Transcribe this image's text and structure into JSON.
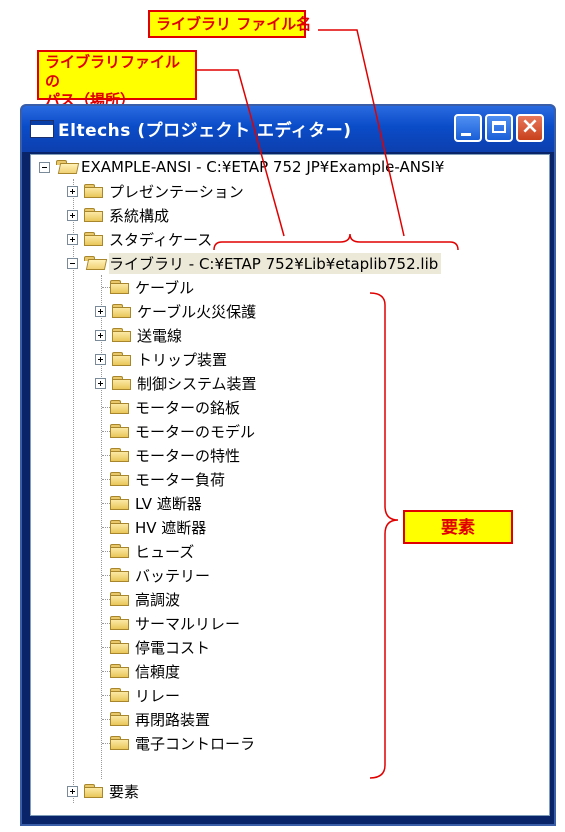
{
  "callouts": {
    "library_file_name": "ライブラリ ファイル名",
    "library_path_line1": "ライブラリファイルの",
    "library_path_line2": "パス（場所）",
    "elements": "要素"
  },
  "window": {
    "title": "Eltechs (プロジェクト エディター)",
    "buttons": {
      "minimize": "minimize",
      "maximize": "maximize",
      "close": "×"
    }
  },
  "tree": {
    "root": "EXAMPLE-ANSI - C:¥ETAP 752 JP¥Example-ANSI¥",
    "top_items": [
      "プレゼンテーション",
      "系統構成",
      "スタディケース"
    ],
    "library": "ライブラリ - C:¥ETAP 752¥Lib¥etaplib752.lib",
    "library_children": [
      {
        "label": "ケーブル",
        "expandable": false
      },
      {
        "label": "ケーブル火災保護",
        "expandable": true
      },
      {
        "label": "送電線",
        "expandable": true
      },
      {
        "label": "トリップ装置",
        "expandable": true
      },
      {
        "label": "制御システム装置",
        "expandable": true
      },
      {
        "label": "モーターの銘板",
        "expandable": false
      },
      {
        "label": "モーターのモデル",
        "expandable": false
      },
      {
        "label": "モーターの特性",
        "expandable": false
      },
      {
        "label": "モーター負荷",
        "expandable": false
      },
      {
        "label": "LV 遮断器",
        "expandable": false
      },
      {
        "label": "HV 遮断器",
        "expandable": false
      },
      {
        "label": "ヒューズ",
        "expandable": false
      },
      {
        "label": "バッテリー",
        "expandable": false
      },
      {
        "label": "高調波",
        "expandable": false
      },
      {
        "label": "サーマルリレー",
        "expandable": false
      },
      {
        "label": "停電コスト",
        "expandable": false
      },
      {
        "label": "信頼度",
        "expandable": false
      },
      {
        "label": "リレー",
        "expandable": false
      },
      {
        "label": "再閉路装置",
        "expandable": false
      },
      {
        "label": "電子コントローラ",
        "expandable": false
      }
    ],
    "last_item": "要素"
  },
  "colors": {
    "callout_fill": "#ffff00",
    "callout_text": "#e00000",
    "titlebar": "#0a4cc8",
    "selection": "#ece9d8"
  }
}
